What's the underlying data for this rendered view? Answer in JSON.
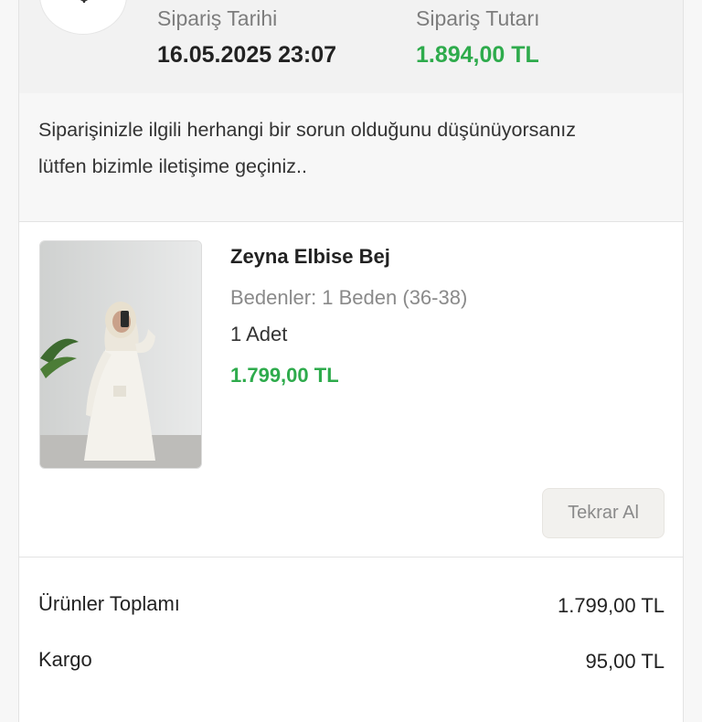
{
  "order": {
    "date_label": "Sipariş Tarihi",
    "date_value": "16.05.2025 23:07",
    "total_label": "Sipariş Tutarı",
    "total_value": "1.894,00 TL",
    "package_icon": "package-icon"
  },
  "notice": {
    "text": "Siparişinizle ilgili herhangi bir sorun olduğunu düşünüyorsanız lütfen bizimle iletişime geçiniz.."
  },
  "product": {
    "title": "Zeyna Elbise Bej",
    "size": "Bedenler: 1 Beden (36-38)",
    "quantity": "1 Adet",
    "price": "1.799,00 TL",
    "reorder_label": "Tekrar Al"
  },
  "summary": {
    "rows": [
      {
        "label": "Ürünler Toplamı",
        "value": "1.799,00 TL"
      },
      {
        "label": "Kargo",
        "value": "95,00 TL"
      }
    ]
  },
  "colors": {
    "accent_green": "#2eab4c",
    "muted_text": "#7d7d7d",
    "header_bg": "#f2f2f2"
  }
}
